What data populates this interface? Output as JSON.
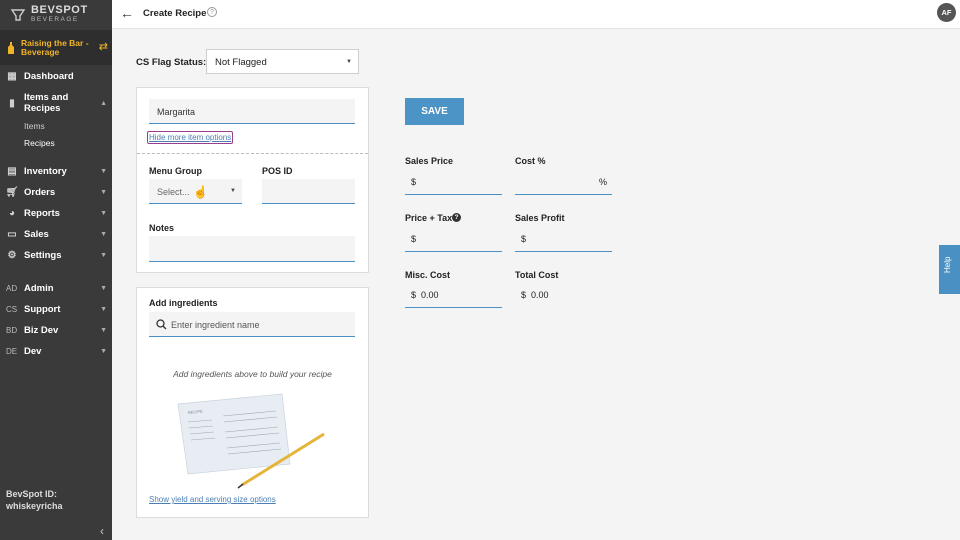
{
  "sidebar": {
    "logo_main": "BEVSPOT",
    "logo_sub": "BEVERAGE",
    "account": "Raising the Bar - Beverage",
    "items": [
      {
        "label": "Dashboard"
      },
      {
        "label": "Items and Recipes"
      },
      {
        "label": "Inventory"
      },
      {
        "label": "Orders"
      },
      {
        "label": "Reports"
      },
      {
        "label": "Sales"
      },
      {
        "label": "Settings"
      }
    ],
    "subitems": [
      "Items",
      "Recipes"
    ],
    "admin_items": [
      {
        "abbr": "AD",
        "label": "Admin"
      },
      {
        "abbr": "CS",
        "label": "Support"
      },
      {
        "abbr": "BD",
        "label": "Biz Dev"
      },
      {
        "abbr": "DE",
        "label": "Dev"
      }
    ],
    "bevspot_id_label": "BevSpot ID:",
    "bevspot_id_value": "whiskeyricha"
  },
  "header": {
    "title": "Create Recipe",
    "avatar": "AF"
  },
  "cs_flag": {
    "label": "CS Flag Status:",
    "value": "Not Flagged"
  },
  "item_form": {
    "name_value": "Margarita",
    "hide_options_link": "Hide more item options",
    "menu_group_label": "Menu Group",
    "menu_group_value": "Select...",
    "pos_id_label": "POS ID",
    "pos_id_value": "",
    "notes_label": "Notes",
    "notes_value": ""
  },
  "ingredients": {
    "title": "Add ingredients",
    "placeholder": "Enter ingredient name",
    "empty_text": "Add ingredients above to build your recipe",
    "illustration_label": "RECIPE",
    "yield_link": "Show yield and serving size options"
  },
  "pricing": {
    "save_label": "SAVE",
    "sales_price_label": "Sales Price",
    "sales_price_currency": "$",
    "sales_price_value": "",
    "cost_pct_label": "Cost %",
    "cost_pct_suffix": "%",
    "price_tax_label": "Price + Tax",
    "price_tax_currency": "$",
    "sales_profit_label": "Sales Profit",
    "sales_profit_currency": "$",
    "misc_cost_label": "Misc. Cost",
    "misc_cost_currency": "$",
    "misc_cost_value": "0.00",
    "total_cost_label": "Total Cost",
    "total_cost_currency": "$",
    "total_cost_value": "0.00"
  },
  "help_tab": "Help",
  "colors": {
    "sidebar_bg": "#3a3a3a",
    "accent": "#4c93c6",
    "account_text": "#f0b429",
    "link": "#4a7fb5",
    "focus_outline": "#9b3d8f"
  }
}
